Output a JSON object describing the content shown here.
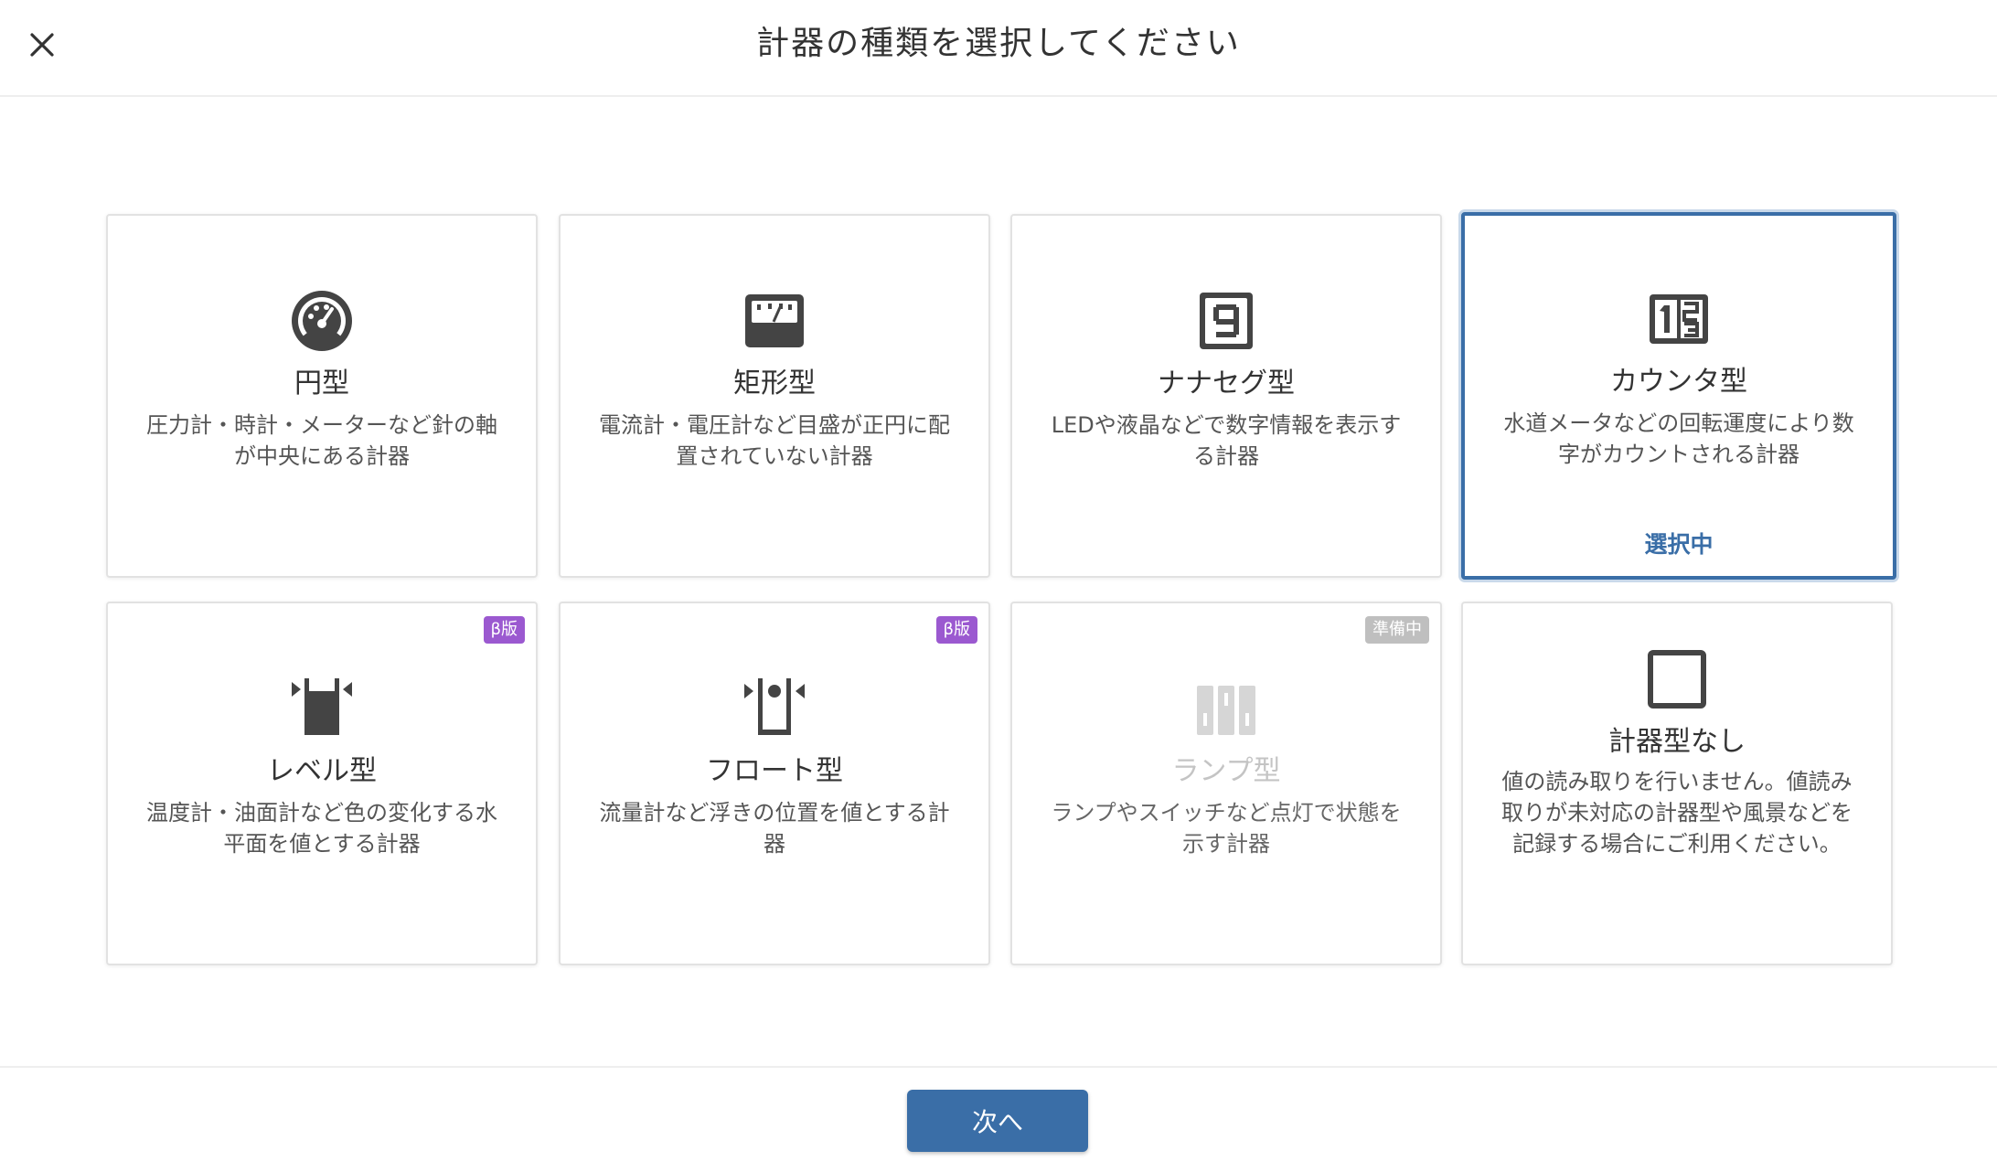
{
  "header": {
    "title": "計器の種類を選択してください",
    "close_icon": "close-icon"
  },
  "cards": [
    {
      "title": "円型",
      "description": "圧力計・時計・メーターなど針の軸が中央にある計器",
      "icon": "gauge-icon",
      "badge": "",
      "status": "available"
    },
    {
      "title": "矩形型",
      "description": "電流計・電圧計など目盛が正円に配置されていない計器",
      "icon": "rectangular-meter-icon",
      "badge": "",
      "status": "available"
    },
    {
      "title": "ナナセグ型",
      "description": "LEDや液晶などで数字情報を表示する計器",
      "icon": "seven-segment-icon",
      "badge": "",
      "status": "available"
    },
    {
      "title": "カウンタ型",
      "description": "水道メータなどの回転運度により数字がカウントされる計器",
      "icon": "counter-icon",
      "badge": "",
      "status": "selected",
      "selected_label": "選択中"
    },
    {
      "title": "レベル型",
      "description": "温度計・油面計など色の変化する水平面を値とする計器",
      "icon": "level-icon",
      "badge": "β版",
      "status": "available"
    },
    {
      "title": "フロート型",
      "description": "流量計など浮きの位置を値とする計器",
      "icon": "float-icon",
      "badge": "β版",
      "status": "available"
    },
    {
      "title": "ランプ型",
      "description": "ランプやスイッチなど点灯で状態を示す計器",
      "icon": "lamp-icon",
      "badge": "準備中",
      "status": "disabled"
    },
    {
      "title": "計器型なし",
      "description": "値の読み取りを行いません。値読み取りが未対応の計器型や風景などを記録する場合にご利用ください。",
      "icon": "empty-square-icon",
      "badge": "",
      "status": "available"
    }
  ],
  "footer": {
    "next_label": "次へ"
  },
  "colors": {
    "accent": "#3a6ea7",
    "beta_badge": "#9b59d0",
    "prep_badge": "#bfbfbf",
    "icon": "#444444",
    "icon_disabled": "#d0d0d0"
  }
}
